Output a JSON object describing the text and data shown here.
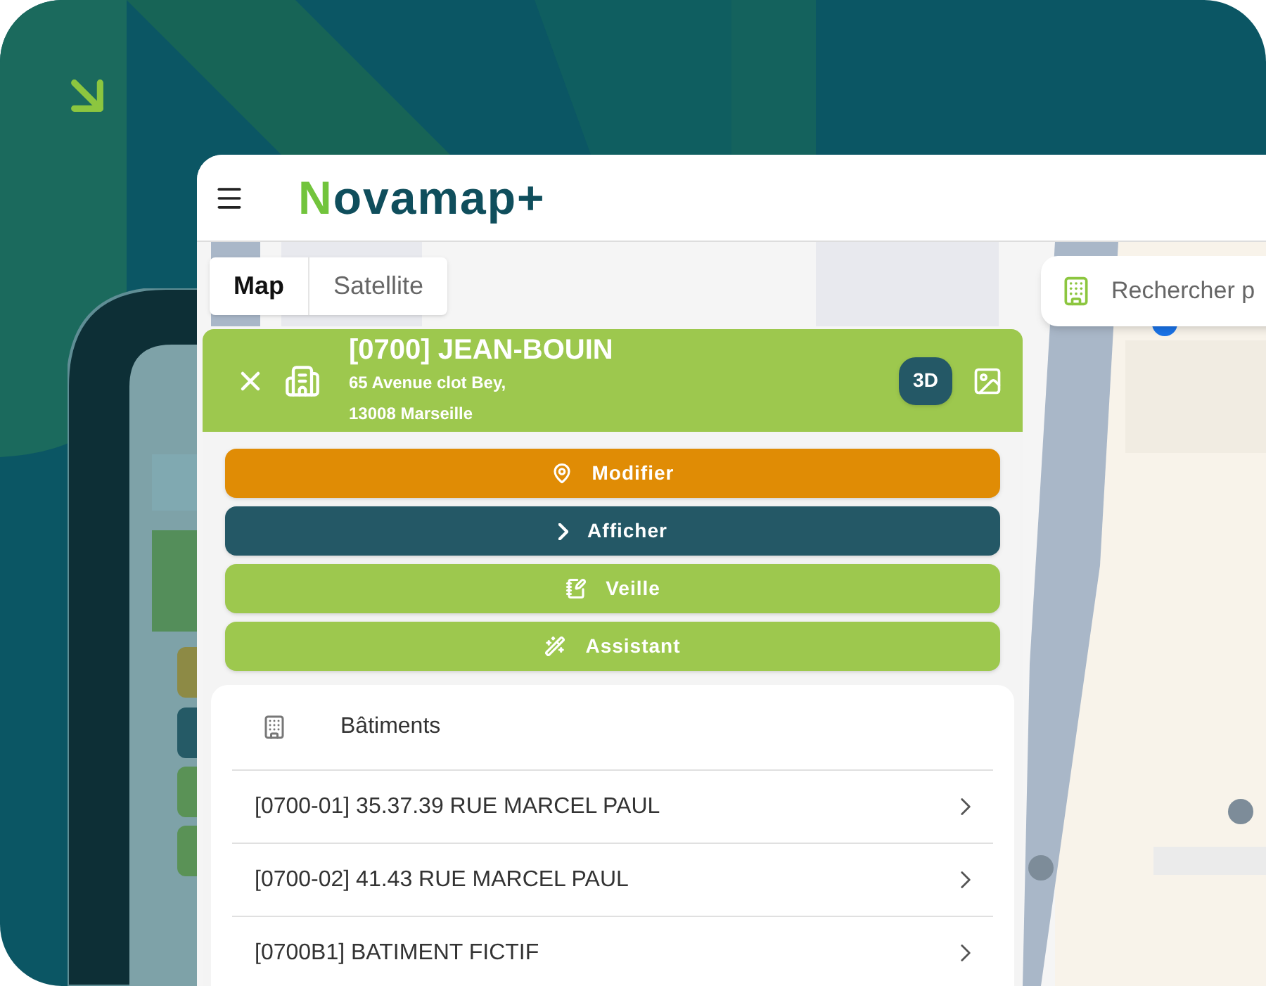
{
  "header": {
    "logo": "Novamap+"
  },
  "map_type_tabs": [
    {
      "label": "Map",
      "selected": true
    },
    {
      "label": "Satellite",
      "selected": false
    }
  ],
  "search": {
    "placeholder": "Rechercher p"
  },
  "site": {
    "title": "[0700] JEAN-BOUIN",
    "address_lines": [
      "65 Avenue clot Bey,",
      "13008 Marseille"
    ],
    "badge": "3D"
  },
  "actions": [
    {
      "label": "Modifier",
      "kind": "edit",
      "color": "#e08c05"
    },
    {
      "label": "Afficher",
      "kind": "show",
      "color": "#245866"
    },
    {
      "label": "Veille",
      "kind": "watch",
      "color": "#9dc84e"
    },
    {
      "label": "Assistant",
      "kind": "assistant",
      "color": "#9dc84e"
    }
  ],
  "buildings": {
    "title": "Bâtiments",
    "items": [
      "[0700-01] 35.37.39 RUE MARCEL PAUL",
      "[0700-02] 41.43 RUE MARCEL PAUL",
      "[0700B1] BATIMENT FICTIF"
    ]
  }
}
